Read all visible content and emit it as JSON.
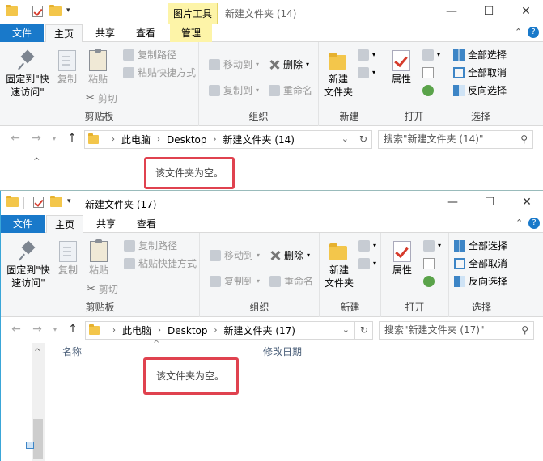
{
  "windows": [
    {
      "id": "w1",
      "context_tab": "图片工具",
      "title": "新建文件夹 (14)",
      "tabs": {
        "file": "文件",
        "home": "主页",
        "share": "共享",
        "view": "查看",
        "manage": "管理"
      },
      "ribbon": {
        "pin_label": "固定到\"快\n速访问\"",
        "copy": "复制",
        "paste": "粘贴",
        "copy_path": "复制路径",
        "paste_shortcut": "粘贴快捷方式",
        "cut": "剪切",
        "clipboard_group": "剪贴板",
        "move_to": "移动到",
        "copy_to": "复制到",
        "delete": "删除",
        "rename": "重命名",
        "organize_group": "组织",
        "new_folder": "新建\n文件夹",
        "new_group": "新建",
        "properties": "属性",
        "open_group": "打开",
        "select_all": "全部选择",
        "select_none": "全部取消",
        "invert_select": "反向选择",
        "select_group": "选择"
      },
      "address": {
        "pc": "此电脑",
        "desktop": "Desktop",
        "folder": "新建文件夹 (14)"
      },
      "search_placeholder": "搜索\"新建文件夹 (14)\"",
      "empty_text": "该文件夹为空。"
    },
    {
      "id": "w2",
      "title": "新建文件夹 (17)",
      "tabs": {
        "file": "文件",
        "home": "主页",
        "share": "共享",
        "view": "查看"
      },
      "ribbon": {
        "pin_label": "固定到\"快\n速访问\"",
        "copy": "复制",
        "paste": "粘贴",
        "copy_path": "复制路径",
        "paste_shortcut": "粘贴快捷方式",
        "cut": "剪切",
        "clipboard_group": "剪贴板",
        "move_to": "移动到",
        "copy_to": "复制到",
        "delete": "删除",
        "rename": "重命名",
        "organize_group": "组织",
        "new_folder": "新建\n文件夹",
        "new_group": "新建",
        "properties": "属性",
        "open_group": "打开",
        "select_all": "全部选择",
        "select_none": "全部取消",
        "invert_select": "反向选择",
        "select_group": "选择"
      },
      "address": {
        "pc": "此电脑",
        "desktop": "Desktop",
        "folder": "新建文件夹 (17)"
      },
      "search_placeholder": "搜索\"新建文件夹 (17)\"",
      "columns": {
        "name": "名称",
        "date": "修改日期"
      },
      "empty_text": "该文件夹为空。"
    }
  ],
  "colors": {
    "file_tab": "#1979ca",
    "context_tab": "#fdf4a8",
    "highlight_box": "#e0424f"
  }
}
